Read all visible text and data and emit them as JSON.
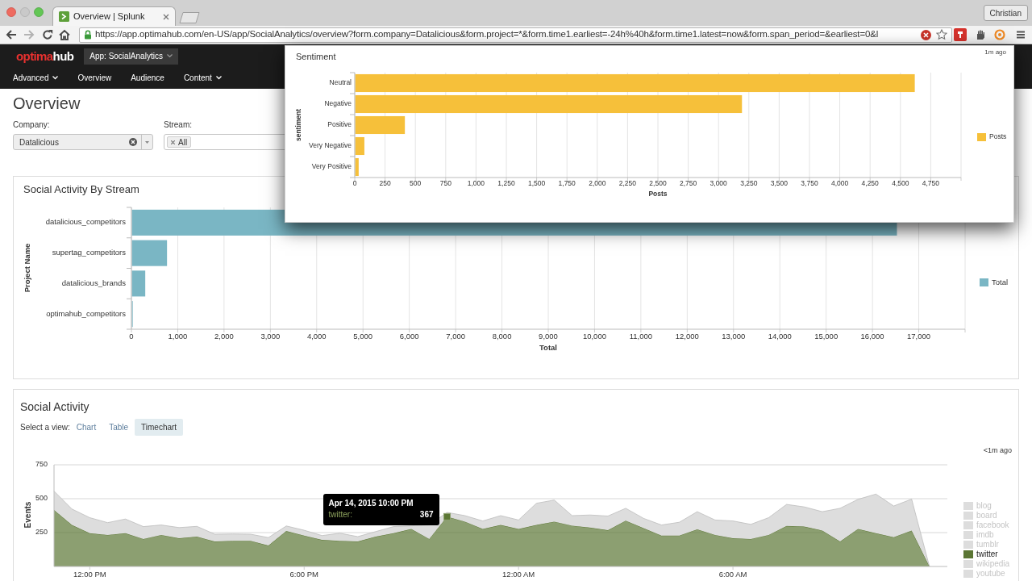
{
  "browser": {
    "tabs": [
      {
        "title": "Overview | Splunk",
        "selected": true
      }
    ],
    "profile": "Christian",
    "url": "https://app.optimahub.com/en-US/app/SocialAnalytics/overview?form.company=Datalicious&form.project=*&form.time1.earliest=-24h%40h&form.time1.latest=now&form.span_period=&earliest=0&l"
  },
  "app": {
    "logo": [
      "optima",
      "hub"
    ],
    "app_menu": "App: SocialAnalytics",
    "nav": [
      {
        "label": "Advanced",
        "dropdown": true
      },
      {
        "label": "Overview",
        "dropdown": false
      },
      {
        "label": "Audience",
        "dropdown": false
      },
      {
        "label": "Content",
        "dropdown": true
      }
    ]
  },
  "page": {
    "title": "Overview",
    "filters": [
      {
        "kind": "dropdown",
        "label": "Company:",
        "value": "Datalicious"
      },
      {
        "kind": "multiselect",
        "label": "Stream:",
        "tokens": [
          "All"
        ]
      }
    ]
  },
  "panels": [
    {
      "title": "Social Activity By Stream",
      "chart_data": {
        "type": "bar",
        "orientation": "horizontal",
        "xlabel": "Total",
        "ylabel": "Project Name",
        "categories": [
          "datalicious_competitors",
          "supertag_competitors",
          "datalicious_brands",
          "optimahub_competitors"
        ],
        "series": [
          {
            "name": "Total",
            "color": "#7ab6c4",
            "values": [
              16520,
              760,
              290,
              20
            ]
          }
        ],
        "xlim": [
          0,
          18000
        ],
        "xticks": [
          0,
          {
            "value": 1000,
            "label": "1,000"
          },
          {
            "value": 2000,
            "label": "2,000"
          },
          {
            "value": 3000,
            "label": "3,000"
          },
          {
            "value": 4000,
            "label": "4,000"
          },
          {
            "value": 5000,
            "label": "5,000"
          },
          {
            "value": 6000,
            "label": "6,000"
          },
          {
            "value": 7000,
            "label": "7,000"
          },
          {
            "value": 8000,
            "label": "8,000"
          },
          {
            "value": 9000,
            "label": "9,000"
          },
          {
            "value": 10000,
            "label": "10,000"
          },
          {
            "value": 11000,
            "label": "11,000"
          },
          {
            "value": 12000,
            "label": "12,000"
          },
          {
            "value": 13000,
            "label": "13,000"
          },
          {
            "value": 14000,
            "label": "14,000"
          },
          {
            "value": 15000,
            "label": "15,000"
          },
          {
            "value": 16000,
            "label": "16,000"
          },
          {
            "value": 17000,
            "label": "17,000"
          }
        ],
        "grid": true,
        "legend": "right"
      }
    },
    {
      "title": "Social Activity",
      "view_label": "Select a view:",
      "views": [
        {
          "label": "Chart",
          "selected": false
        },
        {
          "label": "Table",
          "selected": false
        },
        {
          "label": "Timechart",
          "selected": true
        }
      ],
      "updated": "<1m ago",
      "legend_items": [
        {
          "highlighted": false
        },
        {
          "highlighted": false
        },
        {
          "highlighted": false
        },
        {
          "highlighted": false
        },
        {
          "highlighted": false
        },
        {
          "highlighted": true
        },
        {
          "highlighted": false
        },
        {
          "highlighted": false
        }
      ],
      "tooltip": {
        "title": "Apr 14, 2015 10:00 PM",
        "label": "twitter:"
      },
      "chart_data": {
        "type": "area",
        "stacked": true,
        "ylabel": "Events",
        "grid": true,
        "legend": "right",
        "x": [
          "2015-04-14T11:00",
          "2015-04-14T11:30",
          "2015-04-14T12:00",
          "2015-04-14T12:30",
          "2015-04-14T13:00",
          "2015-04-14T13:30",
          "2015-04-14T14:00",
          "2015-04-14T14:30",
          "2015-04-14T15:00",
          "2015-04-14T15:30",
          "2015-04-14T16:00",
          "2015-04-14T16:30",
          "2015-04-14T17:00",
          "2015-04-14T17:30",
          "2015-04-14T18:00",
          "2015-04-14T18:30",
          "2015-04-14T19:00",
          "2015-04-14T19:30",
          "2015-04-14T20:00",
          "2015-04-14T20:30",
          "2015-04-14T21:00",
          "2015-04-14T21:30",
          "2015-04-14T22:00",
          "2015-04-14T22:30",
          "2015-04-14T23:00",
          "2015-04-14T23:30",
          "2015-04-15T00:00",
          "2015-04-15T00:30",
          "2015-04-15T01:00",
          "2015-04-15T01:30",
          "2015-04-15T02:00",
          "2015-04-15T02:30",
          "2015-04-15T03:00",
          "2015-04-15T03:30",
          "2015-04-15T04:00",
          "2015-04-15T04:30",
          "2015-04-15T05:00",
          "2015-04-15T05:30",
          "2015-04-15T06:00",
          "2015-04-15T06:30",
          "2015-04-15T07:00",
          "2015-04-15T07:30",
          "2015-04-15T08:00",
          "2015-04-15T08:30",
          "2015-04-15T09:00",
          "2015-04-15T09:30",
          "2015-04-15T10:00",
          "2015-04-15T10:30",
          "2015-04-15T11:00",
          "2015-04-15T11:30"
        ],
        "xlim": [
          "2015-04-14T11:00",
          "2015-04-15T12:00"
        ],
        "ylim": [
          0,
          750
        ],
        "xticks": [
          {
            "value": "2015-04-14T12:00",
            "label": "12:00 PM"
          },
          {
            "value": "2015-04-14T18:00",
            "label": "6:00 PM"
          },
          {
            "value": "2015-04-15T00:00",
            "label": "12:00 AM"
          },
          {
            "value": "2015-04-15T06:00",
            "label": "6:00 AM"
          }
        ],
        "yticks": [
          250,
          500,
          750
        ],
        "series": [
          {
            "name": "blog",
            "color": "#dddddd",
            "values": [
              null,
              null,
              null,
              null,
              null,
              null,
              null,
              null,
              null,
              null,
              null,
              null,
              null,
              null,
              null,
              null,
              null,
              null,
              null,
              null,
              null,
              null,
              null,
              null,
              null,
              null,
              null,
              null,
              null,
              null,
              null,
              null,
              null,
              null,
              null,
              null,
              null,
              null,
              null,
              null,
              null,
              null,
              null,
              null,
              null,
              null,
              null,
              null,
              null,
              null
            ]
          },
          {
            "name": "board",
            "color": "#dddddd",
            "values": [
              null,
              null,
              null,
              null,
              null,
              null,
              null,
              null,
              null,
              null,
              null,
              null,
              null,
              null,
              null,
              null,
              null,
              null,
              null,
              null,
              null,
              null,
              null,
              null,
              null,
              null,
              null,
              null,
              null,
              null,
              null,
              null,
              null,
              null,
              null,
              null,
              null,
              null,
              null,
              null,
              null,
              null,
              null,
              null,
              null,
              null,
              null,
              null,
              null,
              null
            ]
          },
          {
            "name": "facebook",
            "color": "#dddddd",
            "values": [
              null,
              null,
              null,
              null,
              null,
              null,
              null,
              null,
              null,
              null,
              null,
              null,
              null,
              null,
              null,
              null,
              null,
              null,
              null,
              null,
              null,
              null,
              null,
              null,
              null,
              null,
              null,
              null,
              null,
              null,
              null,
              null,
              null,
              null,
              null,
              null,
              null,
              null,
              null,
              null,
              null,
              null,
              null,
              null,
              null,
              null,
              null,
              null,
              null,
              null
            ]
          },
          {
            "name": "imdb",
            "color": "#dddddd",
            "values": [
              null,
              null,
              null,
              null,
              null,
              null,
              null,
              null,
              null,
              null,
              null,
              null,
              null,
              null,
              null,
              null,
              null,
              null,
              null,
              null,
              null,
              null,
              null,
              null,
              null,
              null,
              null,
              null,
              null,
              null,
              null,
              null,
              null,
              null,
              null,
              null,
              null,
              null,
              null,
              null,
              null,
              null,
              null,
              null,
              null,
              null,
              null,
              null,
              null,
              null
            ]
          },
          {
            "name": "tumblr",
            "color": "#dddddd",
            "values": [
              null,
              null,
              null,
              null,
              null,
              null,
              null,
              null,
              null,
              null,
              null,
              null,
              null,
              null,
              null,
              null,
              null,
              null,
              null,
              null,
              null,
              null,
              null,
              null,
              null,
              null,
              null,
              null,
              null,
              null,
              null,
              null,
              null,
              null,
              null,
              null,
              null,
              null,
              null,
              null,
              null,
              null,
              null,
              null,
              null,
              null,
              null,
              null,
              null,
              null
            ]
          },
          {
            "name": "twitter",
            "color": "#5b7634",
            "values": [
              416,
              306,
              245,
              233,
              245,
              203,
              233,
              208,
              220,
              184,
              189,
              189,
              154,
              262,
              228,
              196,
              189,
              184,
              220,
              245,
              277,
              203,
              367,
              331,
              277,
              306,
              277,
              306,
              331,
              301,
              287,
              267,
              338,
              282,
              228,
              228,
              274,
              233,
              208,
              203,
              233,
              299,
              294,
              265,
              184,
              277,
              245,
              216,
              265,
              0
            ]
          },
          {
            "name": "wikipedia",
            "color": "#dddddd",
            "values": [
              140,
              118,
              115,
              90,
              105,
              91,
              73,
              79,
              76,
              54,
              51,
              49,
              59,
              37,
              39,
              32,
              56,
              36,
              37,
              49,
              null,
              103,
              32,
              44,
              59,
              69,
              66,
              160,
              159,
              74,
              93,
              105,
              91,
              73,
              78,
              98,
              130,
              110,
              128,
              108,
              127,
              159,
              145,
              139,
              245,
              218,
              289,
              230,
              232,
              0
            ]
          },
          {
            "name": "youtube",
            "color": "#dddddd",
            "values": [
              null,
              null,
              null,
              null,
              null,
              null,
              null,
              null,
              null,
              null,
              null,
              null,
              null,
              null,
              null,
              null,
              null,
              null,
              null,
              null,
              null,
              null,
              null,
              null,
              null,
              null,
              null,
              null,
              null,
              null,
              null,
              null,
              null,
              null,
              null,
              null,
              null,
              null,
              null,
              null,
              null,
              null,
              null,
              null,
              null,
              null,
              null,
              null,
              null,
              null
            ]
          }
        ],
        "annotations": [
          {
            "x": "2015-04-14T22:00",
            "y": 367,
            "text": "367"
          }
        ]
      }
    }
  ],
  "sentiment_popup": {
    "title": "Sentiment",
    "updated": "1m ago",
    "chart_data": {
      "type": "bar",
      "orientation": "horizontal",
      "xlabel": "Posts",
      "ylabel": "sentiment",
      "categories": [
        "Neutral",
        "Negative",
        "Positive",
        "Very Negative",
        "Very Positive"
      ],
      "series": [
        {
          "name": "Posts",
          "color": "#f6c03a",
          "values": [
            4615,
            3190,
            410,
            76,
            29
          ]
        }
      ],
      "xlim": [
        0,
        5000
      ],
      "xticks": [
        0,
        250,
        500,
        750,
        {
          "value": 1000,
          "label": "1,000"
        },
        {
          "value": 1250,
          "label": "1,250"
        },
        {
          "value": 1500,
          "label": "1,500"
        },
        {
          "value": 1750,
          "label": "1,750"
        },
        {
          "value": 2000,
          "label": "2,000"
        },
        {
          "value": 2250,
          "label": "2,250"
        },
        {
          "value": 2500,
          "label": "2,500"
        },
        {
          "value": 2750,
          "label": "2,750"
        },
        {
          "value": 3000,
          "label": "3,000"
        },
        {
          "value": 3250,
          "label": "3,250"
        },
        {
          "value": 3500,
          "label": "3,500"
        },
        {
          "value": 3750,
          "label": "3,750"
        },
        {
          "value": 4000,
          "label": "4,000"
        },
        {
          "value": 4250,
          "label": "4,250"
        },
        {
          "value": 4500,
          "label": "4,500"
        },
        {
          "value": 4750,
          "label": "4,750"
        }
      ],
      "grid": true,
      "legend": "right"
    }
  }
}
